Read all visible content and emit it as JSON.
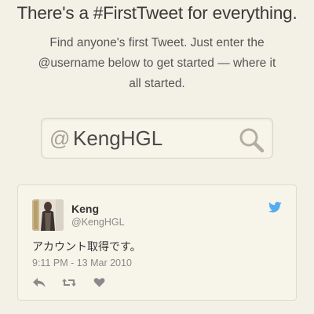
{
  "header": {
    "headline": "There's a #FirstTweet for everything.",
    "subtitle_lines": [
      "Find anyone's first Tweet. Just enter the",
      "@username below to get started — where it",
      "all started."
    ]
  },
  "search": {
    "prefix": "@",
    "value": "KengHGL",
    "icon": "magnifier-icon"
  },
  "tweet": {
    "name": "Keng",
    "handle": "@KengHGL",
    "text": "アカウント取得です。",
    "timestamp": "9:11 PM - 13 Mar 2010",
    "icons": {
      "brand": "twitter-bird-icon",
      "actions": [
        "reply-icon",
        "retweet-icon",
        "favorite-icon"
      ]
    }
  },
  "colors": {
    "background": "#f3f0e6",
    "twitter_blue": "#55acee",
    "muted_gray": "#8a8a8a"
  }
}
